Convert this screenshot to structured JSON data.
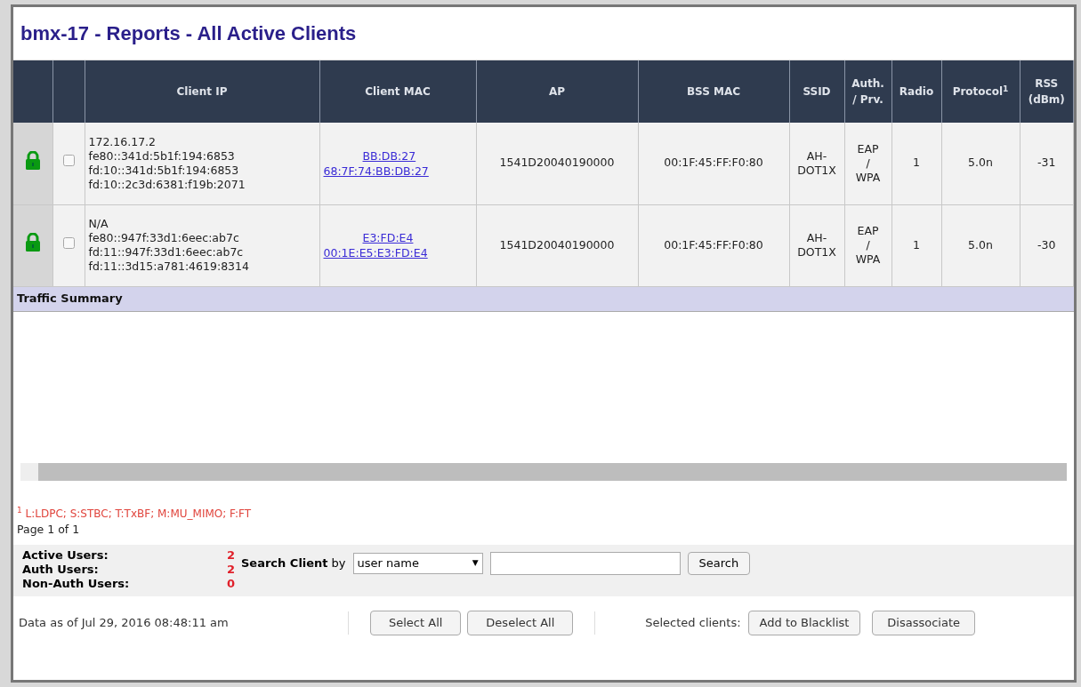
{
  "window": {
    "title": "bmx-17 - Reports - All Active Clients"
  },
  "table": {
    "columns": [
      "Client IP",
      "Client MAC",
      "AP",
      "BSS MAC",
      "SSID",
      "Auth. / Prv.",
      "Radio",
      "Protocol$^{1}$",
      "RSS (dBm)"
    ],
    "rows": [
      {
        "locked": true,
        "checked": false,
        "client_ip": [
          "172.16.17.2",
          "fe80::341d:5b1f:194:6853",
          "fd:10::341d:5b1f:194:6853",
          "fd:10::2c3d:6381:f19b:2071"
        ],
        "client_mac": [
          "BB:DB:27",
          "68:7F:74:BB:DB:27"
        ],
        "ap": "1541D20040190000",
        "bss_mac": "00:1F:45:FF:F0:80",
        "ssid": "AH-DOT1X",
        "auth": [
          "EAP",
          "/",
          "WPA"
        ],
        "radio": "1",
        "protocol": "5.0n",
        "rss": "-31"
      },
      {
        "locked": true,
        "checked": false,
        "client_ip": [
          "N/A",
          "fe80::947f:33d1:6eec:ab7c",
          "fd:11::947f:33d1:6eec:ab7c",
          "fd:11::3d15:a781:4619:8314"
        ],
        "client_mac": [
          "E3:FD:E4",
          "00:1E:E5:E3:FD:E4"
        ],
        "ap": "1541D20040190000",
        "bss_mac": "00:1F:45:FF:F0:80",
        "ssid": "AH-DOT1X",
        "auth": [
          "EAP",
          "/",
          "WPA"
        ],
        "radio": "1",
        "protocol": "5.0n",
        "rss": "-30"
      }
    ],
    "section": "Traffic Summary"
  },
  "footnote": "$^{1}$ L:LDPC; S:STBC; T:TxBF; M:MU_MIMO; F:FT",
  "page": "Page 1 of 1",
  "stats": [
    {
      "label": "Active Users:",
      "value": "2"
    },
    {
      "label": "Auth Users:",
      "value": "2"
    },
    {
      "label": "Non-Auth Users:",
      "value": "0"
    }
  ],
  "search": {
    "label": "Search Client",
    "by": "by",
    "select": "user name",
    "select_arrow": "▼",
    "button": "Search"
  },
  "footer": {
    "data_as_of": "Data as of Jul 29, 2016 08:48:11 am",
    "select_all": "Select All",
    "deselect_all": "Deselect All",
    "selected_label": "Selected clients:",
    "blacklist": "Add to Blacklist",
    "disassociate": "Disassociate"
  }
}
